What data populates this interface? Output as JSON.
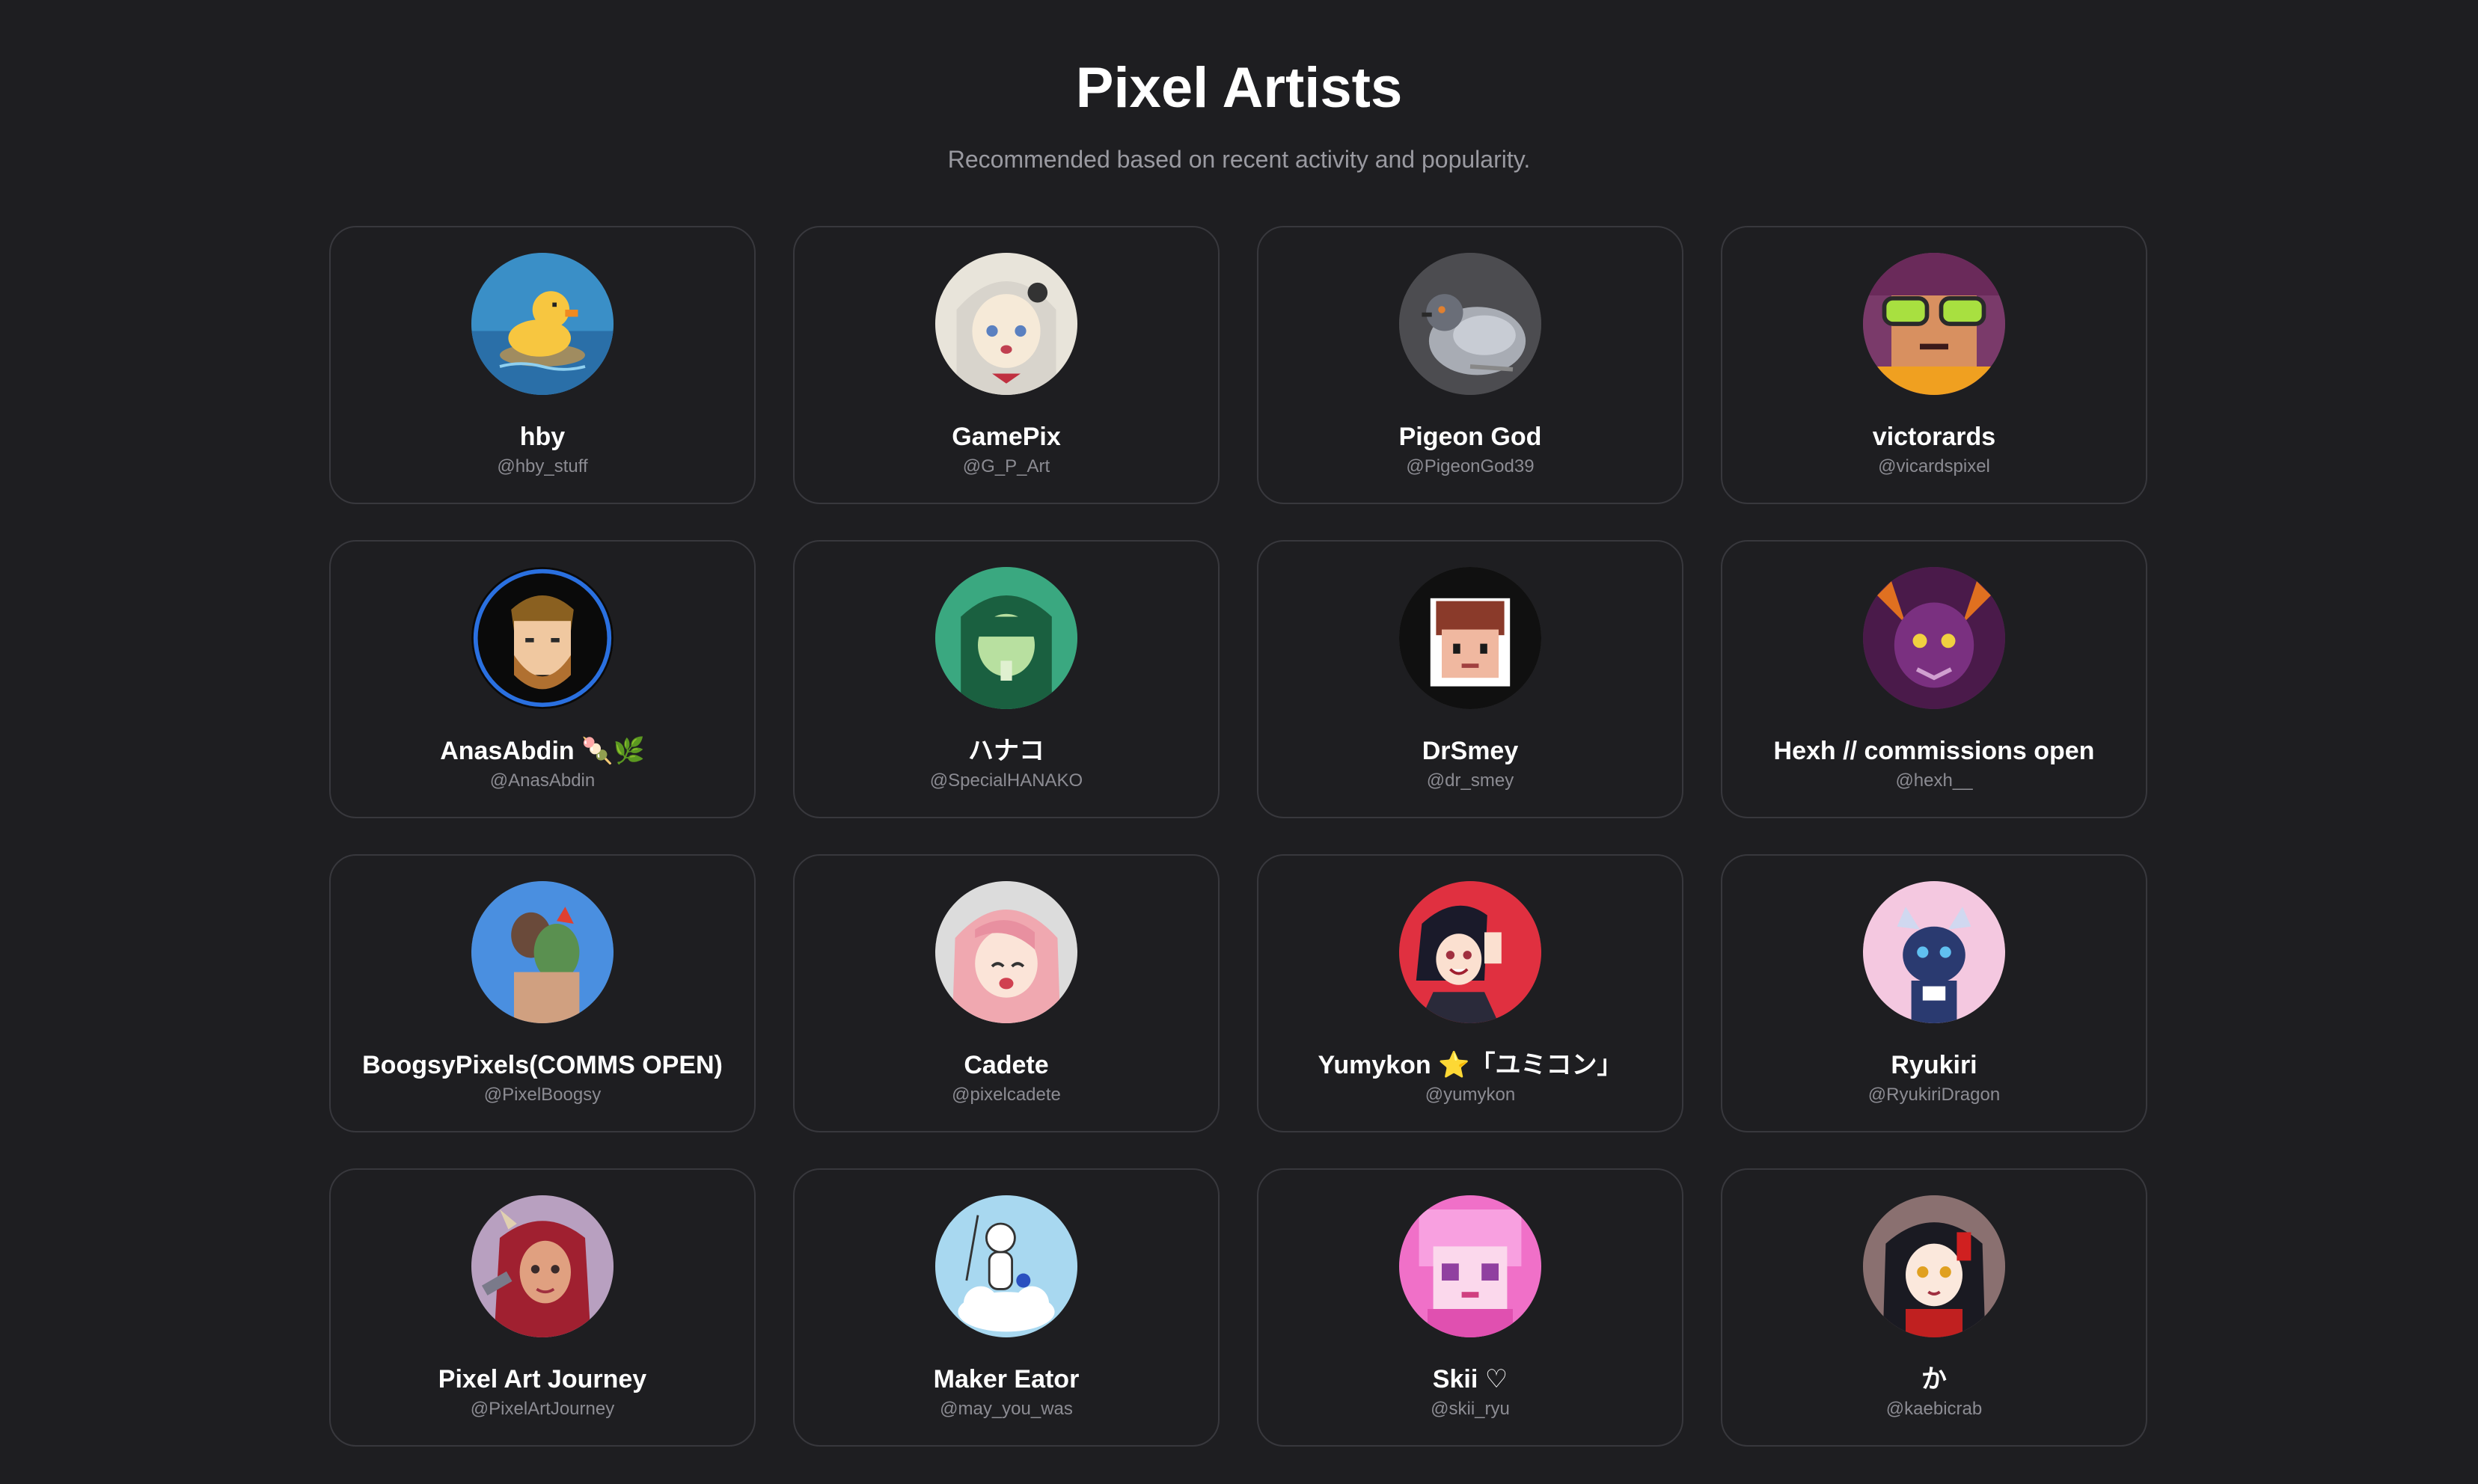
{
  "page": {
    "title": "Pixel Artists",
    "subtitle": "Recommended based on recent activity and popularity."
  },
  "artists": [
    {
      "name": "hby",
      "handle": "@hby_stuff",
      "avatar_icon": "duck-avatar-icon",
      "avatar_bg": "#3a8fc7"
    },
    {
      "name": "GamePix",
      "handle": "@G_P_Art",
      "avatar_icon": "anime-girl-avatar-icon",
      "avatar_bg": "#e8e4da"
    },
    {
      "name": "Pigeon God",
      "handle": "@PigeonGod39",
      "avatar_icon": "pigeon-avatar-icon",
      "avatar_bg": "#5a5a5e"
    },
    {
      "name": "victorards",
      "handle": "@vicardspixel",
      "avatar_icon": "goggles-avatar-icon",
      "avatar_bg": "#7a3a6a"
    },
    {
      "name": "AnasAbdin 🍡🌿",
      "handle": "@AnasAbdin",
      "avatar_icon": "bearded-man-avatar-icon",
      "avatar_bg": "#0a0a0a"
    },
    {
      "name": "ハナコ",
      "handle": "@SpecialHANAKO",
      "avatar_icon": "green-girl-avatar-icon",
      "avatar_bg": "#3aa880"
    },
    {
      "name": "DrSmey",
      "handle": "@dr_smey",
      "avatar_icon": "pixel-boy-avatar-icon",
      "avatar_bg": "#101010"
    },
    {
      "name": "Hexh // commissions open",
      "handle": "@hexh__",
      "avatar_icon": "purple-creature-avatar-icon",
      "avatar_bg": "#4a1a4a"
    },
    {
      "name": "BoogsyPixels(COMMS OPEN)",
      "handle": "@PixelBoogsy",
      "avatar_icon": "two-faces-avatar-icon",
      "avatar_bg": "#4a8fe0"
    },
    {
      "name": "Cadete",
      "handle": "@pixelcadete",
      "avatar_icon": "pink-hair-avatar-icon",
      "avatar_bg": "#dcdcdc"
    },
    {
      "name": "Yumykon ⭐「ユミコン」",
      "handle": "@yumykon",
      "avatar_icon": "red-bg-girl-avatar-icon",
      "avatar_bg": "#e03040"
    },
    {
      "name": "Ryukiri",
      "handle": "@RyukiriDragon",
      "avatar_icon": "blue-dragon-avatar-icon",
      "avatar_bg": "#f4c8e0"
    },
    {
      "name": "Pixel Art Journey",
      "handle": "@PixelArtJourney",
      "avatar_icon": "red-hair-warrior-avatar-icon",
      "avatar_bg": "#b8a0c0"
    },
    {
      "name": "Maker Eator",
      "handle": "@may_you_was",
      "avatar_icon": "cloud-fisher-avatar-icon",
      "avatar_bg": "#a8d8f0"
    },
    {
      "name": "Skii ♡",
      "handle": "@skii_ryu",
      "avatar_icon": "pink-pixel-girl-avatar-icon",
      "avatar_bg": "#f070c8"
    },
    {
      "name": "か",
      "handle": "@kaebicrab",
      "avatar_icon": "dark-hair-girl-avatar-icon",
      "avatar_bg": "#8a7070"
    }
  ]
}
